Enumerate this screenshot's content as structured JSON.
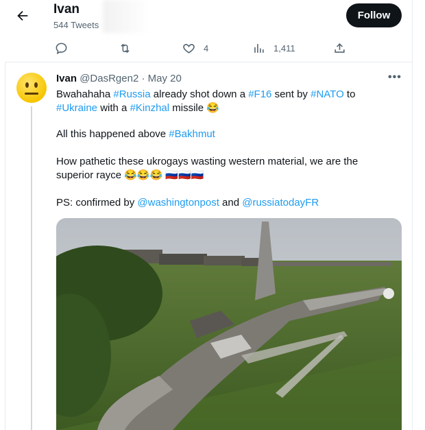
{
  "header": {
    "back_icon": "back-arrow-icon",
    "name": "Ivan",
    "tweet_count": "544 Tweets",
    "follow_label": "Follow"
  },
  "actions": {
    "likes": "4",
    "views": "1,411"
  },
  "tweet": {
    "author": "Ivan",
    "handle": "@DasRgen2",
    "separator": "·",
    "date": "May 20",
    "more": "•••",
    "line1": [
      "Bwahahaha ",
      "#Russia",
      " already shot down a ",
      "#F16",
      " sent by ",
      "#NATO",
      " to"
    ],
    "line2": [
      "#Ukraine",
      " with a ",
      "#Kinzhal",
      " missile 😂"
    ],
    "para2": [
      "All this happened above ",
      "#Bakhmut"
    ],
    "para3a": "How pathetic these ukrogays wasting western material, we are the",
    "para3b": "superior rayce 😂😂😂 🇷🇺🇷🇺🇷🇺",
    "para4": [
      "PS: confirmed by ",
      "@washingtonpost",
      " and ",
      "@russiatodayFR"
    ]
  },
  "colors": {
    "link": "#1d9bf0",
    "text": "#0f1419",
    "muted": "#536471",
    "follow_bg": "#0f1419"
  }
}
